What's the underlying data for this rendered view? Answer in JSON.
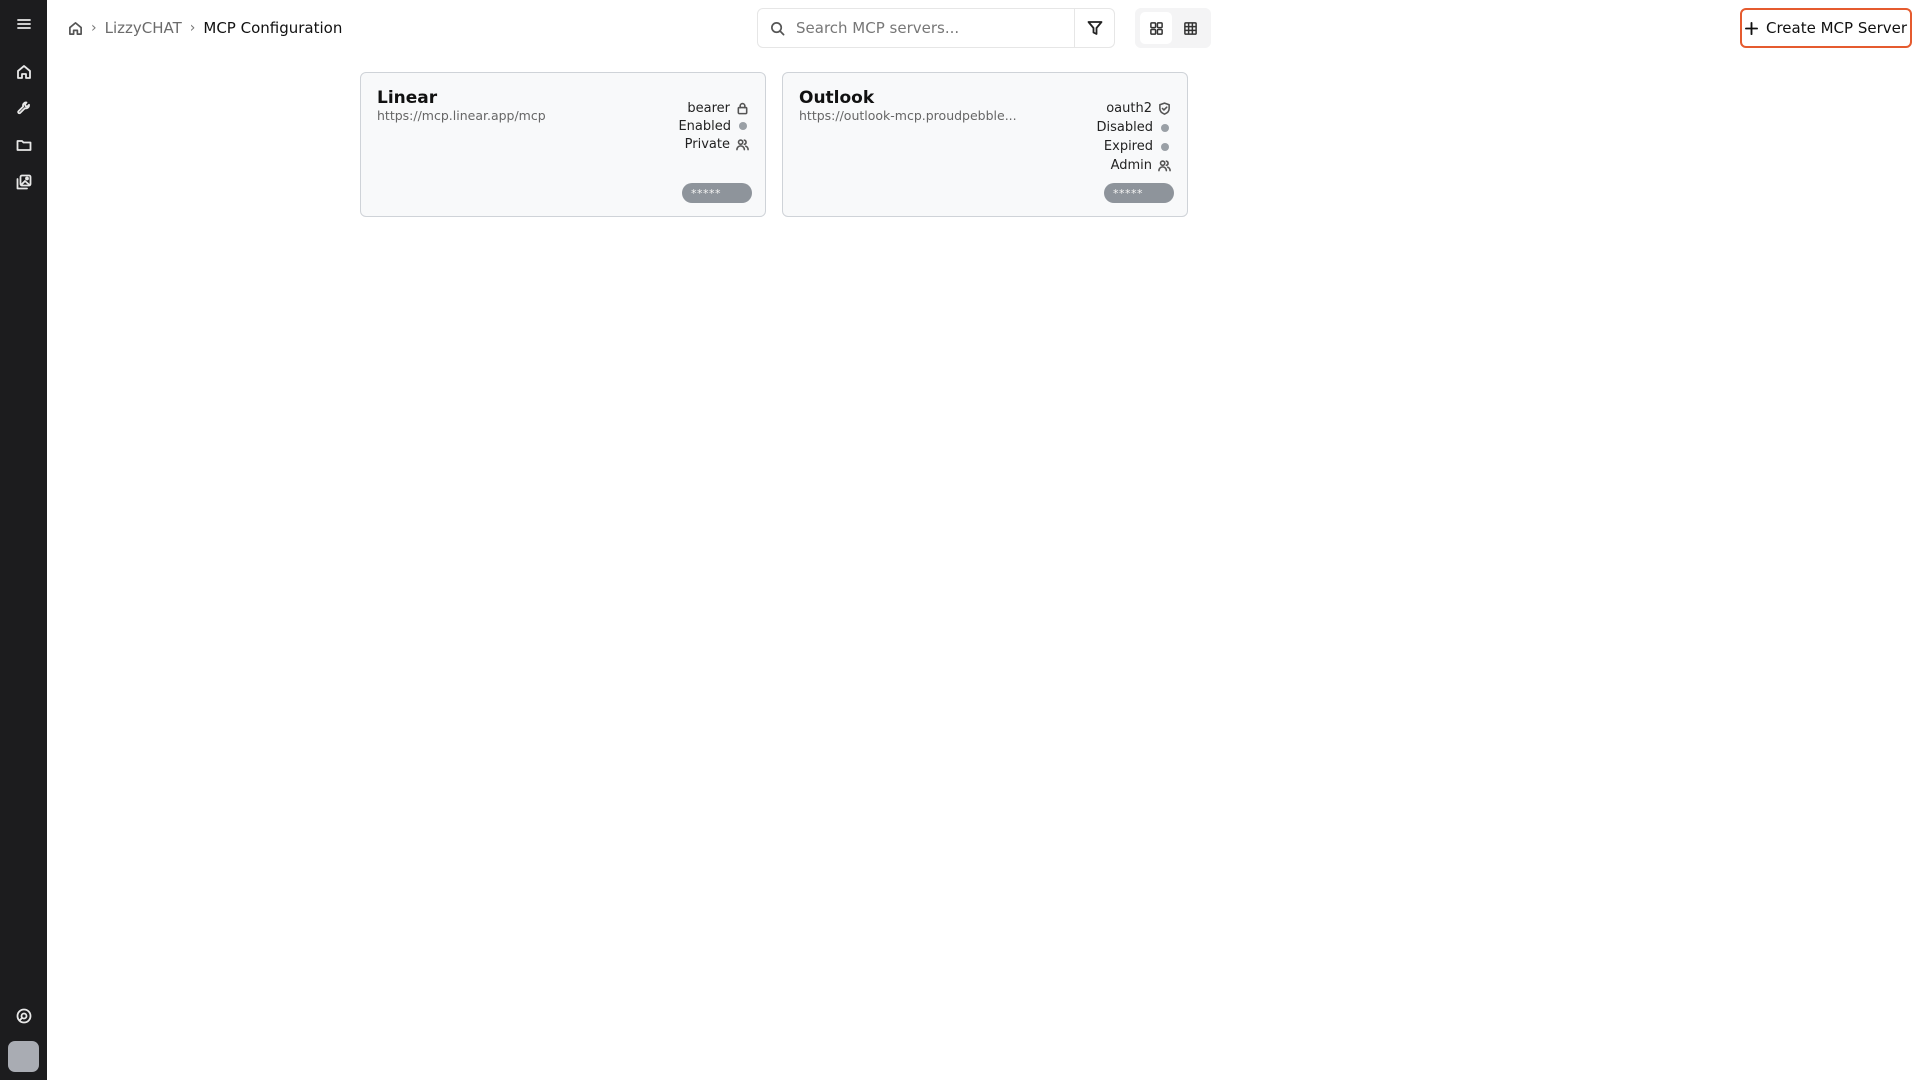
{
  "breadcrumb": {
    "items": [
      {
        "label": "LizzyCHAT"
      },
      {
        "label": "MCP Configuration"
      }
    ],
    "separator": "›"
  },
  "search": {
    "placeholder": "Search MCP servers...",
    "value": ""
  },
  "actions": {
    "create_label": "Create MCP Server"
  },
  "colors": {
    "accent": "#e55b2f",
    "sidebar": "#1c1c1e",
    "pill": "#8e949b"
  },
  "sidebar": {
    "icons": [
      "menu-icon",
      "home-icon",
      "wrench-icon",
      "folder-icon",
      "gallery-icon",
      "support-icon"
    ]
  },
  "servers": [
    {
      "name": "Linear",
      "url": "https://mcp.linear.app/mcp",
      "auth": "bearer",
      "status": "Enabled",
      "visibility": "Private",
      "key_mask": "*****"
    },
    {
      "name": "Outlook",
      "url": "https://outlook-mcp.proudpebble...",
      "auth": "oauth2",
      "status": "Disabled",
      "token_state": "Expired",
      "visibility": "Admin",
      "key_mask": "*****"
    }
  ]
}
